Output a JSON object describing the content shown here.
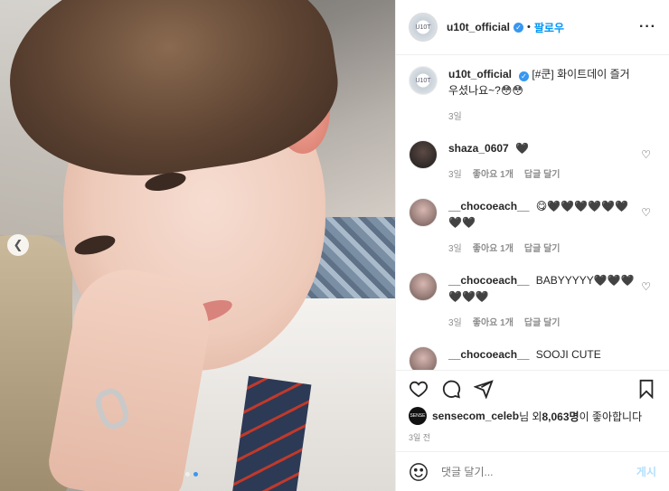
{
  "header": {
    "username": "u10t_official",
    "avatar_text": "U10T",
    "follow_label": "팔로우",
    "more_icon": "···"
  },
  "caption": {
    "username": "u10t_official",
    "text": "[#쿤] 화이트데이 즐거우셨나요~?😳😳",
    "time": "3일"
  },
  "comments": [
    {
      "username": "shaza_0607",
      "text": "🖤",
      "time": "3일",
      "likes": "좋아요 1개",
      "reply": "답글 달기"
    },
    {
      "username": "__chocoeach__",
      "text": "😋🖤🖤🖤🖤🖤🖤🖤🖤",
      "time": "3일",
      "likes": "좋아요 1개",
      "reply": "답글 달기"
    },
    {
      "username": "__chocoeach__",
      "text": "BABYYYYY🖤🖤🖤🖤🖤🖤",
      "time": "3일",
      "likes": "좋아요 1개",
      "reply": "답글 달기"
    },
    {
      "username": "__chocoeach__",
      "text": "SOOJI CUTE",
      "time": "",
      "likes": "",
      "reply": ""
    }
  ],
  "likes": {
    "avatar_text": "SENSE",
    "user": "sensecom_celeb",
    "suffix1": "님 외 ",
    "count": "8,063명",
    "suffix2": "이 좋아합니다"
  },
  "time_ago": "3일 전",
  "add_comment": {
    "placeholder": "댓글 달기...",
    "post_label": "게시"
  },
  "colors": {
    "accent": "#0095f6",
    "verified": "#3897f0",
    "muted": "#8e8e8e"
  },
  "icons": [
    "verified-badge-icon",
    "more-icon",
    "heart-icon",
    "comment-icon",
    "share-icon",
    "save-icon",
    "emoji-icon",
    "chevron-left-icon"
  ]
}
